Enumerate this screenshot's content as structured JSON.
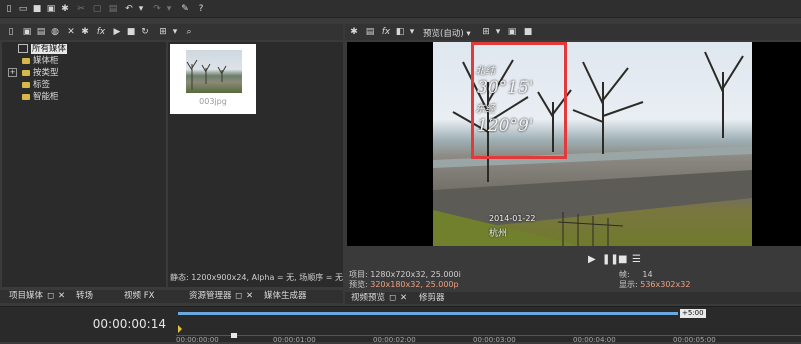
{
  "toolbar": {
    "icons": [
      "new-icon",
      "open-icon",
      "save-icon",
      "save-as-icon",
      "properties-icon",
      "cut-icon",
      "copy-icon",
      "paste-icon",
      "undo-icon",
      "undo-dropdown-icon",
      "redo-icon",
      "redo-dropdown-icon",
      "tools-icon",
      "help-icon"
    ]
  },
  "media_tree": {
    "items": [
      {
        "label": "所有媒体",
        "selected": true
      },
      {
        "label": "媒体柜"
      },
      {
        "label": "按类型",
        "expandable": true
      },
      {
        "label": "标签"
      },
      {
        "label": "智能柜"
      }
    ]
  },
  "media_pool": {
    "thumbnail_caption": "003jpg",
    "status": "静态: 1200x900x24, Alpha = 无, 场顺序 = 无("
  },
  "preview": {
    "mode_label": "预览(自动)",
    "overlay_lines": [
      "30°15'",
      "120°9'"
    ],
    "overlay_small_labels": [
      "北纬",
      "东经"
    ],
    "date_stamp": "2014-01-22",
    "place_stamp": "杭州",
    "info_project_label": "项目:",
    "info_project_value": "1280x720x32, 25.000i",
    "info_preview_label": "预览:",
    "info_preview_value": "320x180x32, 25.000p",
    "frame_label": "帧:",
    "frame_value": "14",
    "display_label": "显示:",
    "display_value": "536x302x32"
  },
  "bottom_tabs_left": [
    "项目媒体",
    "转场",
    "视频 FX",
    "资源管理器",
    "媒体生成器"
  ],
  "bottom_tabs_right": [
    "视频预览",
    "修剪器"
  ],
  "timeline": {
    "timecode": "00:00:00:14",
    "marker_label": "+5:00",
    "ruler": [
      "00:00:00:00",
      "00:00:01:00",
      "00:00:02:00",
      "00:00:03:00",
      "00:00:04:00",
      "00:00:05:00"
    ]
  },
  "colors": {
    "accent_red": "#e03a3a",
    "highlight_value": "#f0a080"
  }
}
